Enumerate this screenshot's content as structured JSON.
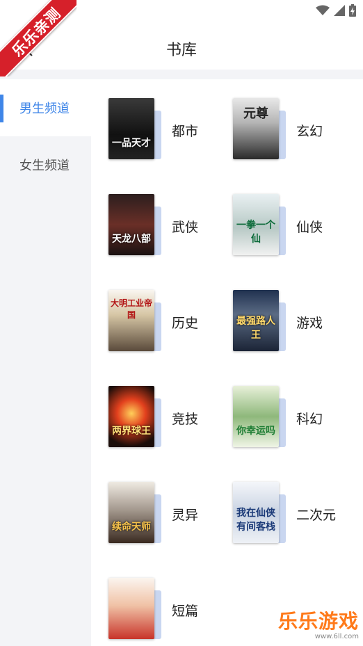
{
  "watermark": {
    "ribbon_text": "乐乐亲测",
    "brand": "乐乐游戏",
    "url": "www.6ll.com"
  },
  "header": {
    "title": "书库"
  },
  "sidebar": {
    "items": [
      {
        "label": "男生频道",
        "active": true
      },
      {
        "label": "女生频道",
        "active": false
      }
    ]
  },
  "categories": [
    {
      "label": "都市",
      "cover_text": "一品天才"
    },
    {
      "label": "玄幻",
      "cover_text": "元尊"
    },
    {
      "label": "武侠",
      "cover_text": "天龙八部"
    },
    {
      "label": "仙侠",
      "cover_text": "一拳一个仙"
    },
    {
      "label": "历史",
      "cover_text": "大明工业帝国"
    },
    {
      "label": "游戏",
      "cover_text": "最强路人王"
    },
    {
      "label": "竞技",
      "cover_text": "两界球王"
    },
    {
      "label": "科幻",
      "cover_text": "你幸运吗"
    },
    {
      "label": "灵异",
      "cover_text": "续命天师"
    },
    {
      "label": "二次元",
      "cover_text": "我在仙侠有间客栈"
    },
    {
      "label": "短篇",
      "cover_text": ""
    }
  ]
}
